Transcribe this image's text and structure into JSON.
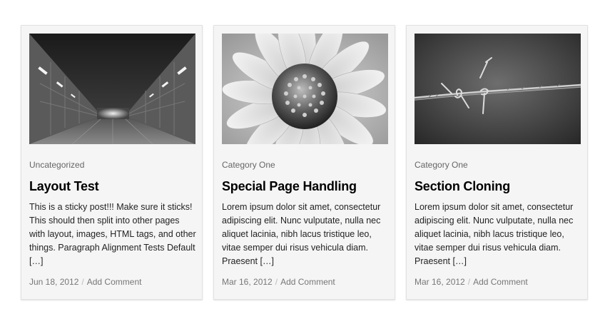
{
  "posts": [
    {
      "image": "tunnel-photo",
      "category": "Uncategorized",
      "title": "Layout Test",
      "excerpt": "This is a sticky post!!! Make sure it sticks! This should then split into other pages with layout, images, HTML tags, and other things. Paragraph Alignment Tests Default […]",
      "date": "Jun 18, 2012",
      "separator": "/",
      "comment_link": "Add Comment"
    },
    {
      "image": "daisy-photo",
      "category": "Category One",
      "title": "Special Page Handling",
      "excerpt": "Lorem ipsum dolor sit amet, consectetur adipiscing elit. Nunc vulputate, nulla nec aliquet lacinia, nibh lacus tristique leo, vitae semper dui risus vehicula diam. Praesent […]",
      "date": "Mar 16, 2012",
      "separator": "/",
      "comment_link": "Add Comment"
    },
    {
      "image": "barbed-wire-photo",
      "category": "Category One",
      "title": "Section Cloning",
      "excerpt": "Lorem ipsum dolor sit amet, consectetur adipiscing elit. Nunc vulputate, nulla nec aliquet lacinia, nibh lacus tristique leo, vitae semper dui risus vehicula diam. Praesent […]",
      "date": "Mar 16, 2012",
      "separator": "/",
      "comment_link": "Add Comment"
    }
  ],
  "colors": {
    "card_background": "#f5f5f5",
    "title": "#000000",
    "meta": "#777777"
  }
}
